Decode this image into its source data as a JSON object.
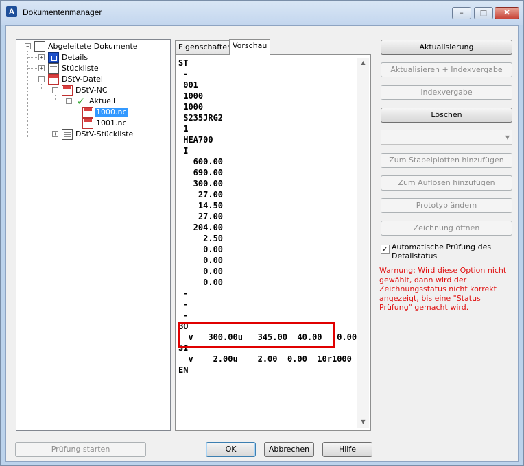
{
  "window": {
    "title": "Dokumentenmanager",
    "app_icon_letter": "A",
    "minimize_symbol": "–",
    "maximize_symbol": "□",
    "close_symbol": "✕"
  },
  "tree": {
    "root": "Abgeleitete Dokumente",
    "details": "Details",
    "stueckliste": "Stückliste",
    "dstv_datei": "DStV-Datei",
    "dstv_nc": "DStV-NC",
    "aktuell": "Aktuell",
    "file_1": "1000.nc",
    "file_2": "1001.nc",
    "dstv_stueckliste": "DStV-Stückliste",
    "expanded_symbol": "−",
    "collapsed_symbol": "+"
  },
  "tabs": {
    "properties": "Eigenschaften",
    "preview": "Vorschau"
  },
  "preview_lines": [
    "ST",
    " -",
    " 001",
    " 1000",
    " 1000",
    " S235JRG2",
    " 1",
    " HEA700",
    " I",
    "   600.00",
    "   690.00",
    "   300.00",
    "    27.00",
    "    14.50",
    "    27.00",
    "   204.00",
    "     2.50",
    "     0.00",
    "     0.00",
    "     0.00",
    "     0.00",
    " -",
    " -",
    " -",
    "BO",
    "  v   300.00u   345.00  40.00   0.00",
    "SI",
    "  v    2.00u    2.00  0.00  10r1000",
    "EN"
  ],
  "buttons": {
    "aktualisierung": "Aktualisierung",
    "aktualisieren_index": "Aktualisieren + Indexvergabe",
    "indexvergabe": "Indexvergabe",
    "loeschen": "Löschen",
    "stapelplotten": "Zum Stapelplotten hinzufügen",
    "aufloesen": "Zum Auflösen hinzufügen",
    "prototyp": "Prototyp ändern",
    "zeichnung": "Zeichnung öffnen",
    "pruefung_starten": "Prüfung starten",
    "ok": "OK",
    "abbrechen": "Abbrechen",
    "hilfe": "Hilfe"
  },
  "checkbox": {
    "label": "Automatische Prüfung des Detailstatus",
    "checked_symbol": "✓"
  },
  "warning": "Warnung: Wird diese Option nicht gewählt, dann wird der Zeichnungsstatus nicht korrekt angezeigt, bis eine \"Status Prüfung\" gemacht wird.",
  "scroll": {
    "up_symbol": "▲",
    "down_symbol": "▼",
    "combo_symbol": "▼"
  },
  "colors": {
    "highlight_box": "#e00000",
    "warning_text": "#e01010",
    "selection": "#3399ff"
  }
}
